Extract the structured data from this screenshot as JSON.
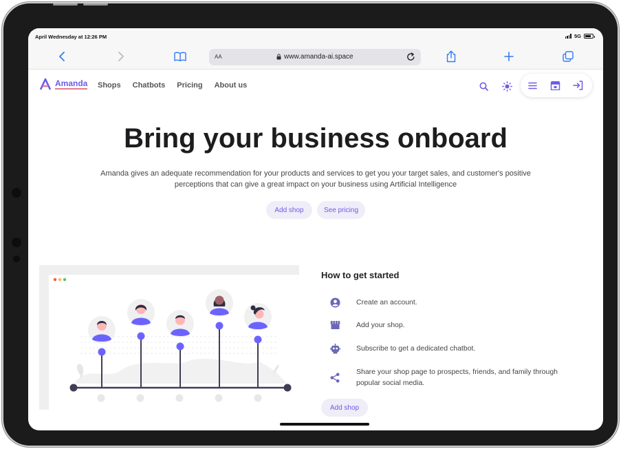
{
  "status_bar": {
    "time": "April Wednesday at 12:26 PM",
    "network": "5G"
  },
  "browser": {
    "text_size_label": "AA",
    "url": "www.amanda-ai.space",
    "accent_color": "#3478f6",
    "icons": [
      "chevron-left-icon",
      "chevron-right-icon",
      "book-icon",
      "lock-icon",
      "reload-icon",
      "share-icon",
      "plus-icon",
      "tabs-icon"
    ]
  },
  "site": {
    "brand": "Amanda",
    "brand_color": "#6c5ce7",
    "nav": [
      "Shops",
      "Chatbots",
      "Pricing",
      "About us"
    ],
    "nav_icons": [
      "search-icon",
      "sun-icon",
      "menu-icon",
      "store-icon",
      "login-icon"
    ]
  },
  "hero": {
    "title": "Bring your business onboard",
    "subtitle_line1": "Amanda gives an adequate recommendation for your products and services to get you your target sales, and customer's positive",
    "subtitle_line2": "perceptions that can give a great impact on your business using Artificial Intelligence",
    "primary_button": "Add shop",
    "secondary_button": "See pricing"
  },
  "getting_started": {
    "title": "How to get started",
    "steps": [
      {
        "icon": "user-circle-icon",
        "text": "Create an account."
      },
      {
        "icon": "shop-icon",
        "text": "Add your shop."
      },
      {
        "icon": "robot-icon",
        "text": "Subscribe to get a dedicated chatbot."
      },
      {
        "icon": "share-nodes-icon",
        "text": "Share your shop page to prospects, friends, and family through popular social media."
      }
    ],
    "button": "Add shop"
  }
}
